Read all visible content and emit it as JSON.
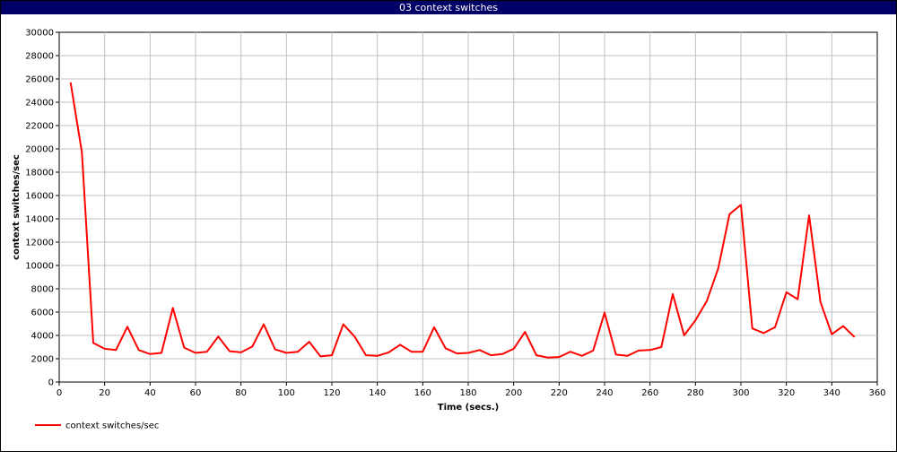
{
  "window": {
    "title": "03 context switches"
  },
  "colors": {
    "title_bar": "#000066",
    "series": "#ff0000",
    "grid": "#c0c0c0"
  },
  "chart_data": {
    "type": "line",
    "title": "03 context switches",
    "xlabel": "Time (secs.)",
    "ylabel": "context switches/sec",
    "xlim": [
      0,
      360
    ],
    "ylim": [
      0,
      30000
    ],
    "xticks": [
      0,
      20,
      40,
      60,
      80,
      100,
      120,
      140,
      160,
      180,
      200,
      220,
      240,
      260,
      280,
      300,
      320,
      340,
      360
    ],
    "yticks": [
      0,
      2000,
      4000,
      6000,
      8000,
      10000,
      12000,
      14000,
      16000,
      18000,
      20000,
      22000,
      24000,
      26000,
      28000,
      30000
    ],
    "grid": true,
    "legend_position": "bottom-left",
    "series": [
      {
        "name": "context switches/sec",
        "color": "#ff0000",
        "x": [
          5,
          10,
          15,
          20,
          25,
          30,
          35,
          40,
          45,
          50,
          55,
          60,
          65,
          70,
          75,
          80,
          85,
          90,
          95,
          100,
          105,
          110,
          115,
          120,
          125,
          130,
          135,
          140,
          145,
          150,
          155,
          160,
          165,
          170,
          175,
          180,
          185,
          190,
          195,
          200,
          205,
          210,
          215,
          220,
          225,
          230,
          235,
          240,
          245,
          250,
          255,
          260,
          265,
          270,
          275,
          280,
          285,
          290,
          295,
          300,
          305,
          310,
          315,
          320,
          325,
          330,
          335,
          340,
          345,
          350
        ],
        "y": [
          25700,
          19700,
          3350,
          2850,
          2750,
          4750,
          2750,
          2400,
          2500,
          6350,
          2950,
          2500,
          2600,
          3900,
          2650,
          2550,
          3050,
          4950,
          2800,
          2500,
          2600,
          3450,
          2200,
          2300,
          4950,
          3900,
          2300,
          2250,
          2550,
          3200,
          2600,
          2600,
          4700,
          2900,
          2450,
          2500,
          2750,
          2300,
          2400,
          2850,
          4300,
          2300,
          2100,
          2150,
          2600,
          2250,
          2700,
          5950,
          2350,
          2250,
          2700,
          2750,
          3000,
          7550,
          4000,
          5300,
          6950,
          9750,
          14400,
          15200,
          4600,
          4200,
          4700,
          7700,
          7100,
          14300,
          6850,
          4100,
          4800,
          3850
        ]
      }
    ]
  }
}
